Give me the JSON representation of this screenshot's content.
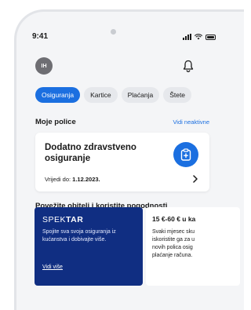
{
  "status_bar": {
    "time": "9:41",
    "icons": [
      "signal-icon",
      "wifi-icon",
      "battery-icon"
    ]
  },
  "header": {
    "avatar_initials": "IH",
    "notifications_icon": "bell-icon"
  },
  "tabs": [
    {
      "label": "Osiguranja",
      "active": true
    },
    {
      "label": "Kartice",
      "active": false
    },
    {
      "label": "Plaćanja",
      "active": false
    },
    {
      "label": "Štete",
      "active": false
    }
  ],
  "policies": {
    "title": "Moje police",
    "link": "Vidi neaktivne",
    "card": {
      "name": "Dodatno zdravstveno osiguranje",
      "valid_label": "Vrijedi do:",
      "valid_date": "1.12.2023.",
      "icon": "clipboard-icon"
    }
  },
  "promo": {
    "title": "Povežite obitelj i koristite pogodnosti",
    "card1": {
      "brand_light": "SPEK",
      "brand_bold": "TAR",
      "text": "Spojite sva svoja osiguranja iz kućanstva i dobivajte više.",
      "link": "Vidi više"
    },
    "card2": {
      "title": "15 €-60 € u ka",
      "lines": [
        "Svaki mjesec sku",
        "iskoristite ga za u",
        "novih polica osig",
        "plaćanje računa."
      ]
    }
  },
  "colors": {
    "accent": "#1b6fe0",
    "promo_bg": "#102e82",
    "screen_bg": "#f4f5f7"
  }
}
